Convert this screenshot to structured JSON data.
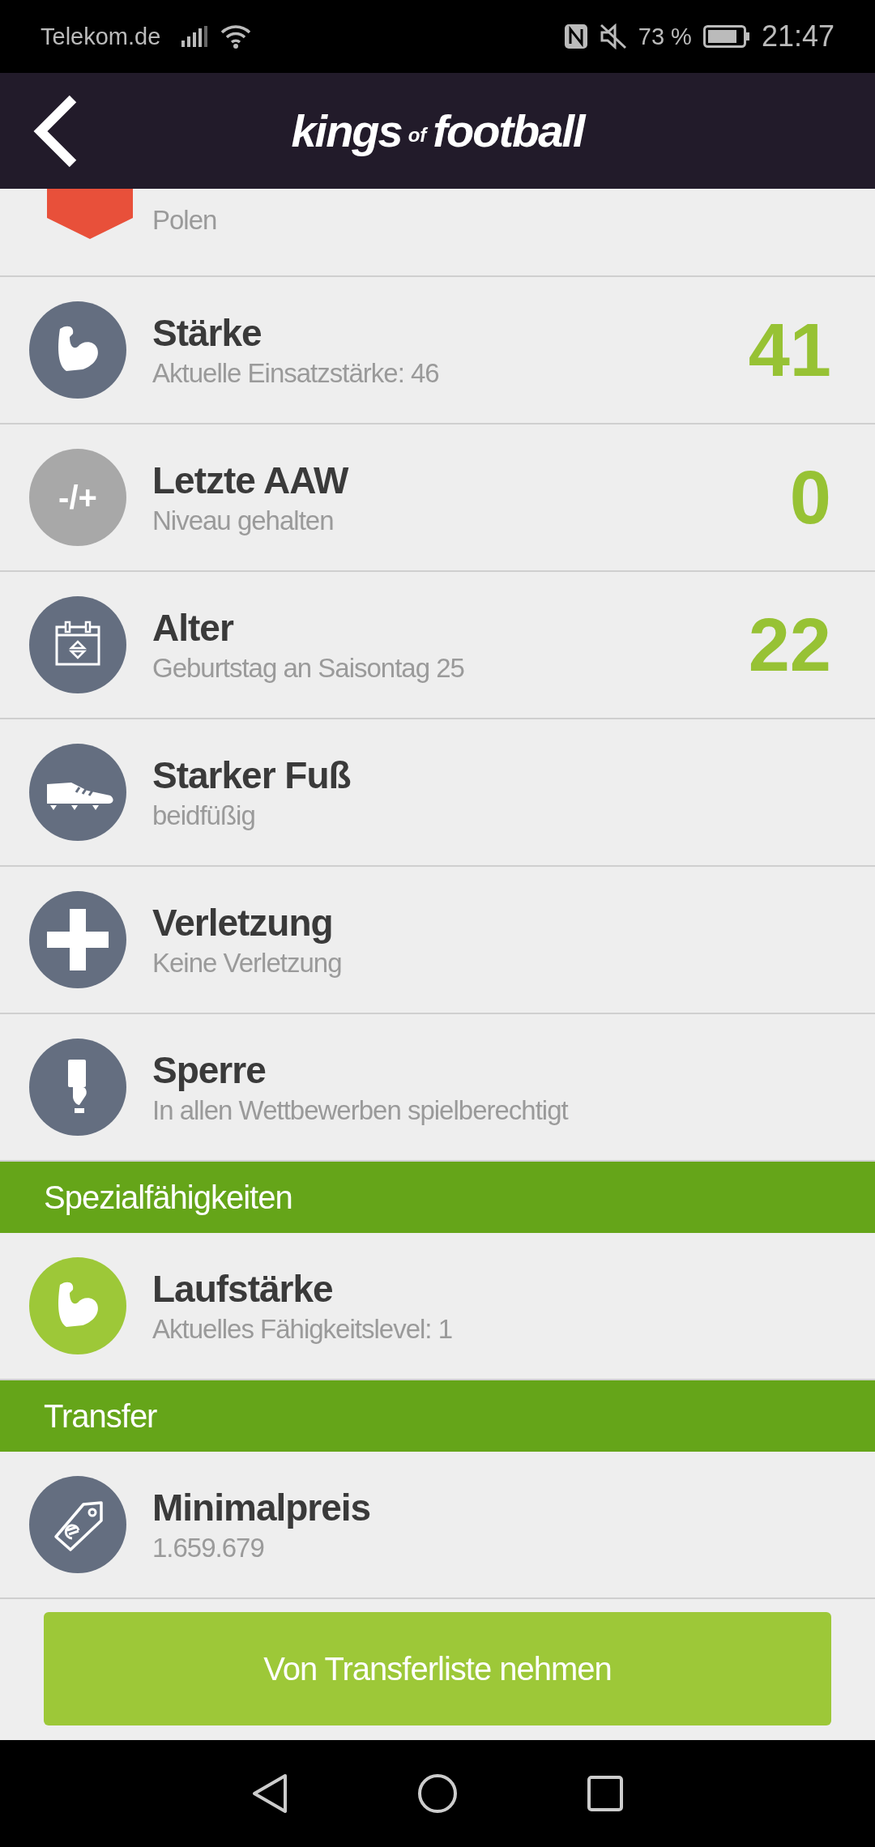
{
  "status_bar": {
    "carrier": "Telekom.de",
    "battery": "73 %",
    "time": "21:47"
  },
  "header": {
    "logo": [
      "kings",
      "of",
      "football"
    ]
  },
  "partial_row": {
    "subtitle": "Polen"
  },
  "sections": [
    {
      "rows": [
        {
          "kind": "muscle",
          "color": "#646e80",
          "title": "Stärke",
          "subtitle": "Aktuelle Einsatzstärke: 46",
          "value": "41"
        },
        {
          "kind": "plusminus",
          "color": "#a8a8a8",
          "icon_text": "-/+",
          "title": "Letzte AAW",
          "subtitle": "Niveau gehalten",
          "value": "0"
        },
        {
          "kind": "calendar",
          "color": "#646e80",
          "title": "Alter",
          "subtitle": "Geburtstag an Saisontag 25",
          "value": "22"
        },
        {
          "kind": "boot",
          "color": "#646e80",
          "title": "Starker Fuß",
          "subtitle": "beidfüßig"
        },
        {
          "kind": "cross",
          "color": "#646e80",
          "title": "Verletzung",
          "subtitle": "Keine Verletzung"
        },
        {
          "kind": "card",
          "color": "#646e80",
          "title": "Sperre",
          "subtitle": "In allen Wettbewerben spielberechtigt"
        }
      ]
    },
    {
      "heading": "Spezialfähigkeiten",
      "rows": [
        {
          "kind": "muscle",
          "color": "#9dc838",
          "title": "Laufstärke",
          "subtitle": "Aktuelles Fähigkeitslevel: 1"
        }
      ]
    },
    {
      "heading": "Transfer",
      "rows": [
        {
          "kind": "tag",
          "color": "#646e80",
          "title": "Minimalpreis",
          "subtitle": "1.659.679"
        }
      ]
    }
  ],
  "action_button": "Von Transferliste nehmen"
}
